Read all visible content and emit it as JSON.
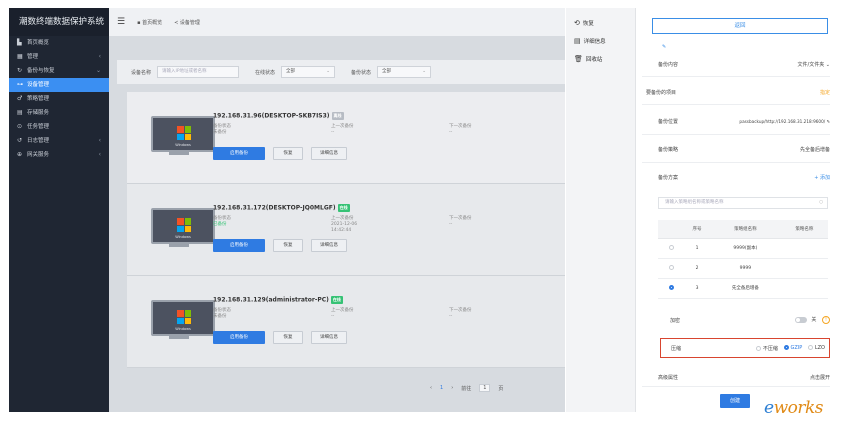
{
  "sidebar": {
    "title": "潮数终端数据保护系统",
    "items": [
      {
        "label": "首页概览",
        "icon": "dashboard-icon",
        "arrow": ""
      },
      {
        "label": "管理",
        "icon": "grid-icon",
        "arrow": "‹"
      },
      {
        "label": "备份与恢复",
        "icon": "refresh-icon",
        "arrow": "⌄"
      },
      {
        "label": "设备管理",
        "icon": "device-icon",
        "arrow": ""
      },
      {
        "label": "策略管理",
        "icon": "policy-icon",
        "arrow": ""
      },
      {
        "label": "存储服务",
        "icon": "storage-icon",
        "arrow": ""
      },
      {
        "label": "任务管理",
        "icon": "task-icon",
        "arrow": ""
      },
      {
        "label": "日志管理",
        "icon": "log-icon",
        "arrow": "‹"
      },
      {
        "label": "网关服务",
        "icon": "gateway-icon",
        "arrow": "‹"
      }
    ]
  },
  "topbar": {
    "tabs": [
      "首页概览",
      "设备管理"
    ]
  },
  "filter": {
    "device_label": "设备名称",
    "device_placeholder": "请输入IP地址或者名称",
    "online_label": "在线状态",
    "online_value": "全部",
    "backup_label": "备份状态",
    "backup_value": "全部"
  },
  "cards": [
    {
      "title": "192.168.31.96(DESKTOP-SKB7IS3)",
      "badge": "离线",
      "status_label": "备份状态",
      "status_value": "未备份",
      "last_label": "上一次备份",
      "last_value": "--",
      "next_label": "下一次备份",
      "next_value": "--",
      "btn_start": "启用备份",
      "btn_restore": "恢复",
      "btn_detail": "详细信息"
    },
    {
      "title": "192.168.31.172(DESKTOP-JQ0MLGF)",
      "badge": "在线",
      "status_label": "备份状态",
      "status_value": "已备份",
      "last_label": "上一次备份",
      "last_value": "2021-12-06",
      "last_value2": "14:42:44",
      "next_label": "下一次备份",
      "next_value": "--",
      "btn_start": "启用备份",
      "btn_restore": "恢复",
      "btn_detail": "详细信息"
    },
    {
      "title": "192.168.31.129(administrator-PC)",
      "badge": "在线",
      "status_label": "备份状态",
      "status_value": "未备份",
      "last_label": "上一次备份",
      "last_value": "--",
      "next_label": "下一次备份",
      "next_value": "--",
      "btn_start": "启用备份",
      "btn_restore": "恢复",
      "btn_detail": "详细信息"
    }
  ],
  "monitor_label": "Windows",
  "pager": {
    "prev": "‹",
    "current": "1",
    "next": "›",
    "goto_label": "前往",
    "goto_value": "1",
    "page_suffix": "页"
  },
  "right_menu": {
    "items": [
      {
        "label": "恢复",
        "icon": "restore-icon"
      },
      {
        "label": "详细信息",
        "icon": "details-icon"
      },
      {
        "label": "回收站",
        "icon": "trash-icon"
      }
    ]
  },
  "form": {
    "back_label": "返回",
    "edit_icon": "✎",
    "content_label": "备份内容",
    "content_value": "文件/文件夹 ⌄",
    "items_label": "要备份的项目",
    "items_value": "指定",
    "location_label": "备份位置",
    "location_value": "passbackup/http://192.168.31.218:9600/ ✎",
    "strategy_label": "备份策略",
    "strategy_value": "先全备后增备",
    "plan_label": "备份方案",
    "plan_add": "+ 添加",
    "plan_search_placeholder": "请输入策略组名称或策略名称",
    "table_headers": [
      "",
      "序号",
      "策略组名称",
      "策略名称"
    ],
    "table_rows": [
      {
        "index": "1",
        "group": "9999(副本)",
        "policy": "",
        "selected": false
      },
      {
        "index": "2",
        "group": "9999",
        "policy": "",
        "selected": false
      },
      {
        "index": "3",
        "group": "先全备后增备",
        "policy": "",
        "selected": true
      }
    ],
    "encrypt_label": "加密",
    "encrypt_value": "关",
    "compress_label": "压缩",
    "compress_options": [
      "不压缩",
      "GZIP",
      "LZO"
    ],
    "compress_selected": "GZIP",
    "advanced_label": "高级属性",
    "advanced_value": "点击展开",
    "create_label": "创建"
  },
  "watermark": {
    "prefix": "e",
    "rest": "works"
  },
  "colors": {
    "accent": "#2f7be2",
    "sidebar_bg": "#1f2633",
    "online": "#36c275",
    "offline": "#b7bcc4",
    "highlight_border": "#d8452f",
    "watermark_orange": "#e08a16",
    "watermark_blue": "#2d7fd3"
  }
}
